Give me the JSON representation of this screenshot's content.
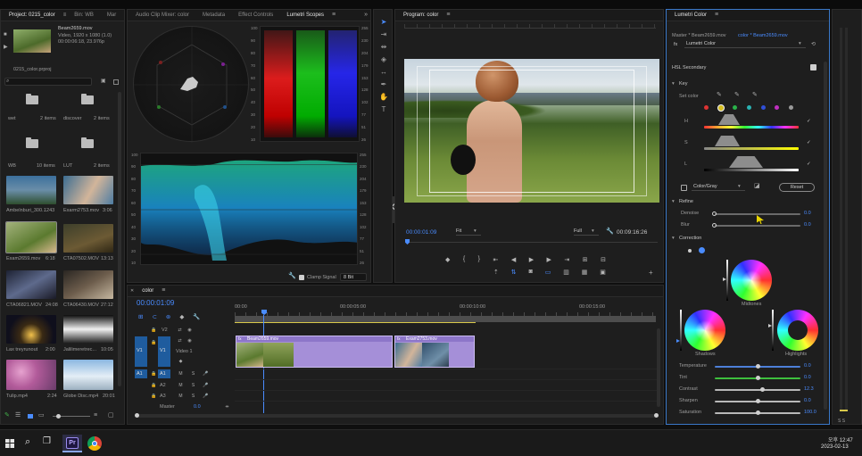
{
  "project": {
    "tabs": [
      "Project: 0215_color",
      "Bin: WB",
      "Mar"
    ],
    "clip_name": "Beam2659.mov",
    "clip_info1": "Video, 1920 x 1080 (1.0)",
    "clip_info2": "00:00:06:18, 23.976p",
    "project_file": "0215_color.prproj",
    "folders": [
      {
        "name": "wet",
        "count": "2 items"
      },
      {
        "name": "discover",
        "count": "2 items"
      },
      {
        "name": "WB",
        "count": "10 items"
      },
      {
        "name": "LUT",
        "count": "2 items"
      }
    ],
    "clips": [
      {
        "name": "Ambelnburi_300...",
        "dur": "1243"
      },
      {
        "name": "Exarm2753.mov",
        "dur": "3:06"
      },
      {
        "name": "Exam2659.mov",
        "dur": "6:18"
      },
      {
        "name": "CTA07502.MOV",
        "dur": "13:13"
      },
      {
        "name": "CTA06821.MOV",
        "dur": "24:08"
      },
      {
        "name": "CTA06430.MOV",
        "dur": "27:12"
      },
      {
        "name": "Lax treyrunout",
        "dur": "2:00"
      },
      {
        "name": "Jalilimeretrec...",
        "dur": "10:05"
      },
      {
        "name": "Tulip.mp4",
        "dur": "2:24"
      },
      {
        "name": "Globe Disc.mp4",
        "dur": "20:01"
      }
    ]
  },
  "scopes": {
    "tabs": [
      "Audio Clip Mixer: color",
      "Metadata",
      "Effect Controls",
      "Lumetri Scopes"
    ],
    "parade_scale": [
      "100",
      "90",
      "80",
      "70",
      "60",
      "50",
      "40",
      "30",
      "20",
      "10"
    ],
    "parade_right": [
      "255",
      "230",
      "204",
      "179",
      "153",
      "128",
      "102",
      "77",
      "51",
      "26"
    ],
    "waveform_scale": [
      "100",
      "90",
      "80",
      "70",
      "60",
      "50",
      "40",
      "30",
      "20",
      "10"
    ],
    "waveform_right": [
      "255",
      "230",
      "204",
      "179",
      "153",
      "128",
      "102",
      "77",
      "51",
      "26"
    ],
    "clamp_label": "Clamp Signal",
    "bit_value": "8 Bit"
  },
  "program": {
    "title": "Program: color",
    "timecode": "00:00:01:09",
    "fit": "Fit",
    "quality": "Full",
    "duration": "00:09:16:26"
  },
  "timeline": {
    "tab": "color",
    "timecode": "00:00:01:09",
    "ruler": [
      "00:00",
      "00:00:05:00",
      "00:00:10:00",
      "00:00:15:00"
    ],
    "tracks": [
      {
        "id": "V2",
        "label": ""
      },
      {
        "id": "V1",
        "label": "Video 1"
      },
      {
        "id": "A1",
        "label": ""
      },
      {
        "id": "A2",
        "label": ""
      },
      {
        "id": "A3",
        "label": ""
      }
    ],
    "master_label": "Master",
    "master_value": "0.0",
    "clip1": "Beam2659.mov",
    "clip2": "Exam2753.mov"
  },
  "lumetri": {
    "tab": "Lumetri Color",
    "source": "Master * Beam2659.mov",
    "sequence": "color * Beam2659.mov",
    "effect": "Lumetri Color",
    "fx": "fx",
    "section": "HSL Secondary",
    "key_label": "Key",
    "set_color": "Set color",
    "h": "H",
    "s": "S",
    "l": "L",
    "color_gray": "Color/Gray",
    "reset": "Reset",
    "refine": "Refine",
    "denoise_label": "Denoise",
    "denoise_value": "0.0",
    "blur_label": "Blur",
    "blur_value": "0.0",
    "correction": "Correction",
    "midtones": "Midtones",
    "shadows": "Shadows",
    "highlights": "Highlights",
    "controls": [
      {
        "label": "Temperature",
        "value": "0.0",
        "color": "#4d7fd8",
        "knob": 0.5
      },
      {
        "label": "Tint",
        "value": "0.0",
        "color": "#3dbf3d",
        "knob": 0.5
      },
      {
        "label": "Contrast",
        "value": "12.3",
        "color": "#b8b8b8",
        "knob": 0.56
      },
      {
        "label": "Sharpen",
        "value": "0.0",
        "color": "#b8b8b8",
        "knob": 0.5
      },
      {
        "label": "Saturation",
        "value": "100.0",
        "color": "#b8b8b8",
        "knob": 0.5
      }
    ]
  },
  "taskbar": {
    "time": "오후 12:47",
    "date": "2023-02-13"
  }
}
